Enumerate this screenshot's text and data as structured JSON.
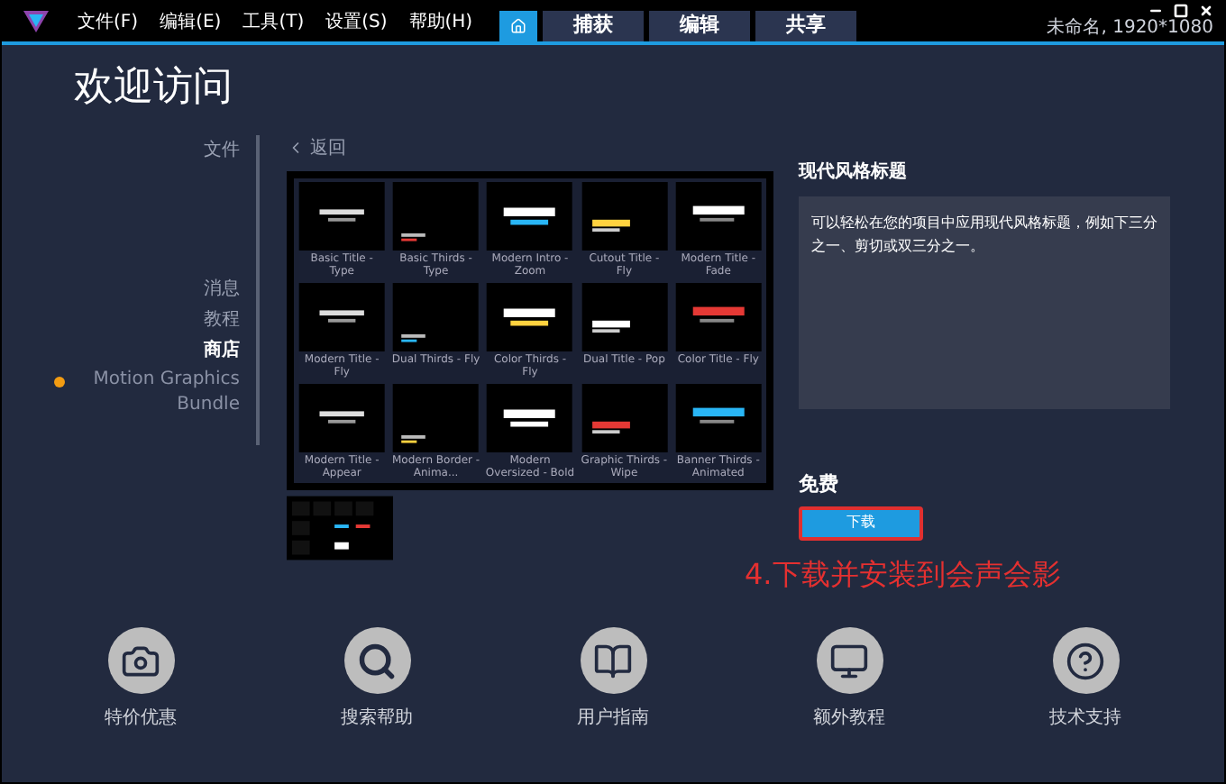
{
  "menu": [
    "文件(F)",
    "编辑(E)",
    "工具(T)",
    "设置(S)",
    "帮助(H)"
  ],
  "tabs": [
    {
      "kind": "home",
      "selected": true
    },
    {
      "label": "捕获",
      "kind": "text",
      "selected": false
    },
    {
      "label": "编辑",
      "kind": "text",
      "selected": false
    },
    {
      "label": "共享",
      "kind": "text",
      "selected": false
    }
  ],
  "project_info": "未命名, 1920*1080",
  "page_title": "欢迎访问",
  "sidebar": {
    "items": [
      {
        "label": "文件",
        "selected": false
      },
      {
        "label": "消息",
        "selected": false
      },
      {
        "label": "教程",
        "selected": false
      },
      {
        "label": "商店",
        "selected": true
      }
    ],
    "bundle": {
      "label": "Motion Graphics Bundle",
      "color": "#f39c12"
    }
  },
  "back": "返回",
  "gallery": [
    {
      "label": "Basic Title - Type"
    },
    {
      "label": "Basic Thirds - Type"
    },
    {
      "label": "Modern Intro - Zoom"
    },
    {
      "label": "Cutout Title - Fly"
    },
    {
      "label": "Modern Title - Fade"
    },
    {
      "label": "Modern Title - Fly"
    },
    {
      "label": "Dual Thirds - Fly"
    },
    {
      "label": "Color Thirds - Fly"
    },
    {
      "label": "Dual Title - Pop"
    },
    {
      "label": "Color Title - Fly"
    },
    {
      "label": "Modern Title - Appear"
    },
    {
      "label": "Modern Border - Anima..."
    },
    {
      "label": "Modern Oversized - Bold"
    },
    {
      "label": "Graphic Thirds - Wipe"
    },
    {
      "label": "Banner Thirds - Animated"
    }
  ],
  "product": {
    "title": "现代风格标题",
    "description": "可以轻松在您的项目中应用现代风格标题，例如下三分之一、剪切或双三分之一。",
    "price": "免费",
    "button": "下载"
  },
  "annotation": "4.下载并安装到会声会影",
  "footer": [
    {
      "label": "特价优惠",
      "kind": "camera"
    },
    {
      "label": "搜索帮助",
      "kind": "search"
    },
    {
      "label": "用户指南",
      "kind": "book"
    },
    {
      "label": "额外教程",
      "kind": "monitor"
    },
    {
      "label": "技术支持",
      "kind": "help"
    }
  ]
}
